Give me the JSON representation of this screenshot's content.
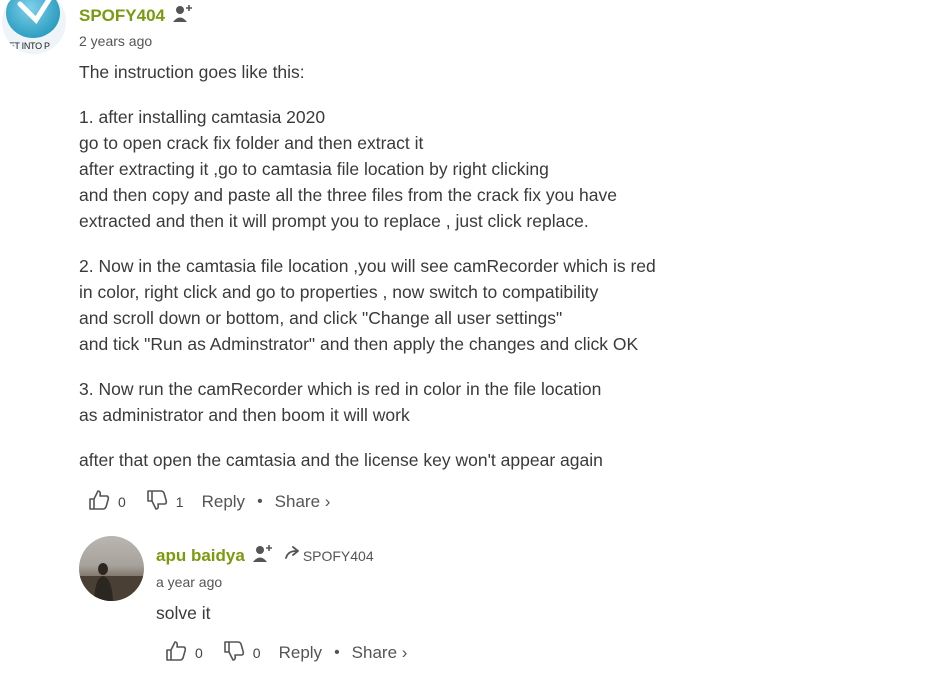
{
  "comment": {
    "avatar_caption": "GET INTO P",
    "author": "SPOFY404",
    "timestamp": "2 years ago",
    "paragraphs": [
      "The instruction goes like this:",
      "1. after installing camtasia 2020\ngo to open crack fix folder and then extract it\nafter extracting it ,go to camtasia file location by right clicking\nand then copy and paste all the three files from the crack fix you have\nextracted and then it will prompt you to replace , just click replace.",
      "2. Now in the camtasia file location ,you will see camRecorder which is red\nin color, right click and go to properties , now switch to compatibility\nand scroll down or bottom, and click \"Change all user settings\"\nand tick \"Run as Adminstrator\" and then apply the changes and click OK",
      "3. Now run the camRecorder which is red in color in the file location\nas administrator and then boom it will work",
      "after that open the camtasia and the license key won't appear again"
    ],
    "likes": "0",
    "dislikes": "1",
    "reply_label": "Reply",
    "dot": "•",
    "share_label": "Share ›"
  },
  "reply": {
    "author": "apu baidya",
    "reply_to": "SPOFY404",
    "timestamp": "a year ago",
    "text": "solve it",
    "likes": "0",
    "dislikes": "0",
    "reply_label": "Reply",
    "dot": "•",
    "share_label": "Share ›"
  },
  "icons": [
    "add-user-icon",
    "thumbs-up-icon",
    "thumbs-down-icon",
    "reply-arrow-icon"
  ]
}
